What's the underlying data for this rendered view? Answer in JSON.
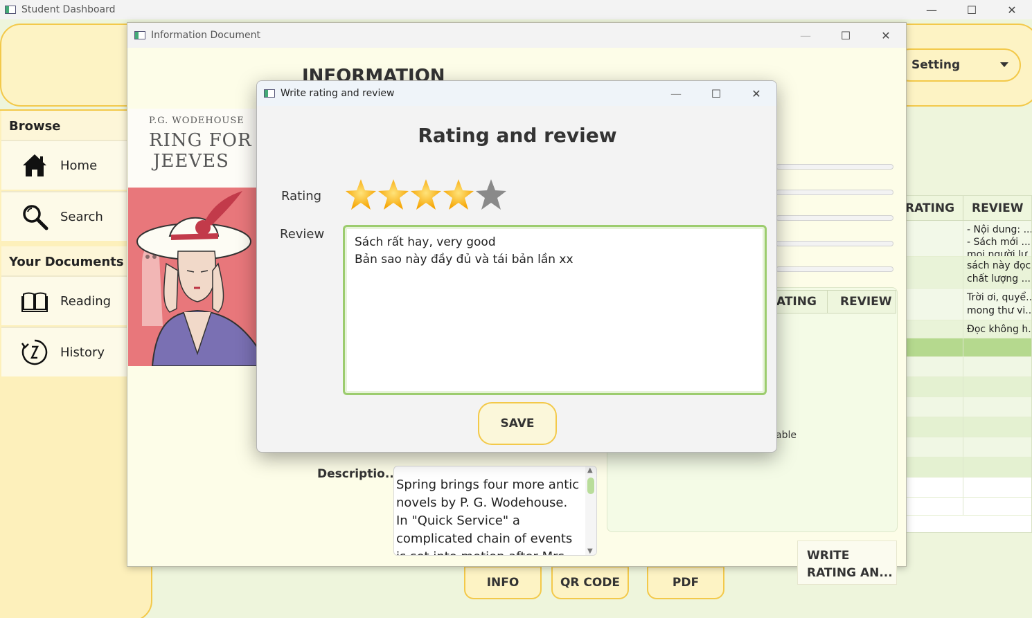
{
  "main_window": {
    "title": "Student Dashboard",
    "minimize_glyph": "—",
    "maximize_glyph": "☐",
    "close_glyph": "✕"
  },
  "header": {
    "setting_label": "Setting"
  },
  "sidebar": {
    "browse_label": "Browse",
    "your_documents_label": "Your Documents",
    "items": [
      {
        "label": "Home",
        "icon": "home-icon"
      },
      {
        "label": "Search",
        "icon": "search-icon"
      },
      {
        "label": "Reading",
        "icon": "book-icon"
      },
      {
        "label": "History",
        "icon": "history-icon"
      }
    ]
  },
  "right_table": {
    "headers": [
      "RATING",
      "REVIEW"
    ],
    "rows": [
      {
        "review": "- Nội dung: ...\n- Sách mới ...\nmọi người lư..."
      },
      {
        "review": "sách này đọc...\nchất lượng ..."
      },
      {
        "review": "Trời ơi, quyể...\nmong thư vi..."
      },
      {
        "review": "Đọc không h..."
      }
    ]
  },
  "bottom_buttons": {
    "info": "INFO",
    "qr_code": "QR CODE",
    "pdf": "PDF"
  },
  "info_window": {
    "title": "Information Document",
    "heading": "INFORMATION",
    "cover": {
      "author": "P.G. WODEHOUSE",
      "title_line1": "RING FOR",
      "title_line2": "JEEVES"
    },
    "table_headers": [
      "ATING",
      "REVIEW"
    ],
    "availability_text": "able",
    "write_button": "WRITE\nRATING AN...",
    "description_label": "Descriptio...",
    "description_text": "Spring brings four more antic novels by P. G. Wodehouse. In \"Quick Service\" a complicated chain of events is set into motion after Mrs Chavender takes a bit"
  },
  "dialog": {
    "title": "Write rating and review",
    "heading": "Rating and review",
    "rating_label": "Rating",
    "review_label": "Review",
    "rating": {
      "value": 4,
      "max": 5
    },
    "review_text": "Sách rất hay, very good\nBản sao này đầy đủ và tái bản lần xx",
    "save_label": "SAVE"
  },
  "colors": {
    "accent_yellow": "#f3c94a",
    "star_filled": "#f5a300",
    "star_empty": "#8a8a8a",
    "review_border": "#9ccc6e"
  }
}
